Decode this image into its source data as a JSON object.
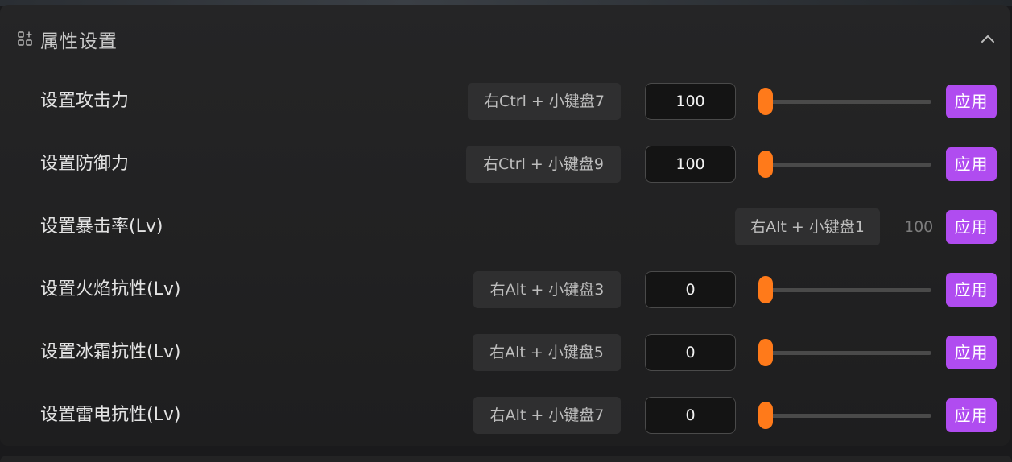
{
  "panel": {
    "title": "属性设置",
    "icon": "grid-add-icon",
    "collapse_icon": "chevron-up-icon"
  },
  "colors": {
    "accent_orange": "#ff7a1a",
    "apply_purple": "#b04cf0"
  },
  "rows": [
    {
      "label": "设置攻击力",
      "hotkey": "右Ctrl + 小键盘7",
      "value": "100",
      "slider_fraction": 0.0,
      "apply_label": "应用",
      "type": "input"
    },
    {
      "label": "设置防御力",
      "hotkey": "右Ctrl + 小键盘9",
      "value": "100",
      "slider_fraction": 0.0,
      "apply_label": "应用",
      "type": "input"
    },
    {
      "label": "设置暴击率(Lv)",
      "hotkey": "右Alt + 小键盘1",
      "value": "100",
      "apply_label": "应用",
      "type": "static"
    },
    {
      "label": "设置火焰抗性(Lv)",
      "hotkey": "右Alt + 小键盘3",
      "value": "0",
      "slider_fraction": 0.0,
      "apply_label": "应用",
      "type": "input"
    },
    {
      "label": "设置冰霜抗性(Lv)",
      "hotkey": "右Alt + 小键盘5",
      "value": "0",
      "slider_fraction": 0.0,
      "apply_label": "应用",
      "type": "input"
    },
    {
      "label": "设置雷电抗性(Lv)",
      "hotkey": "右Alt + 小键盘7",
      "value": "0",
      "slider_fraction": 0.0,
      "apply_label": "应用",
      "type": "input"
    }
  ]
}
